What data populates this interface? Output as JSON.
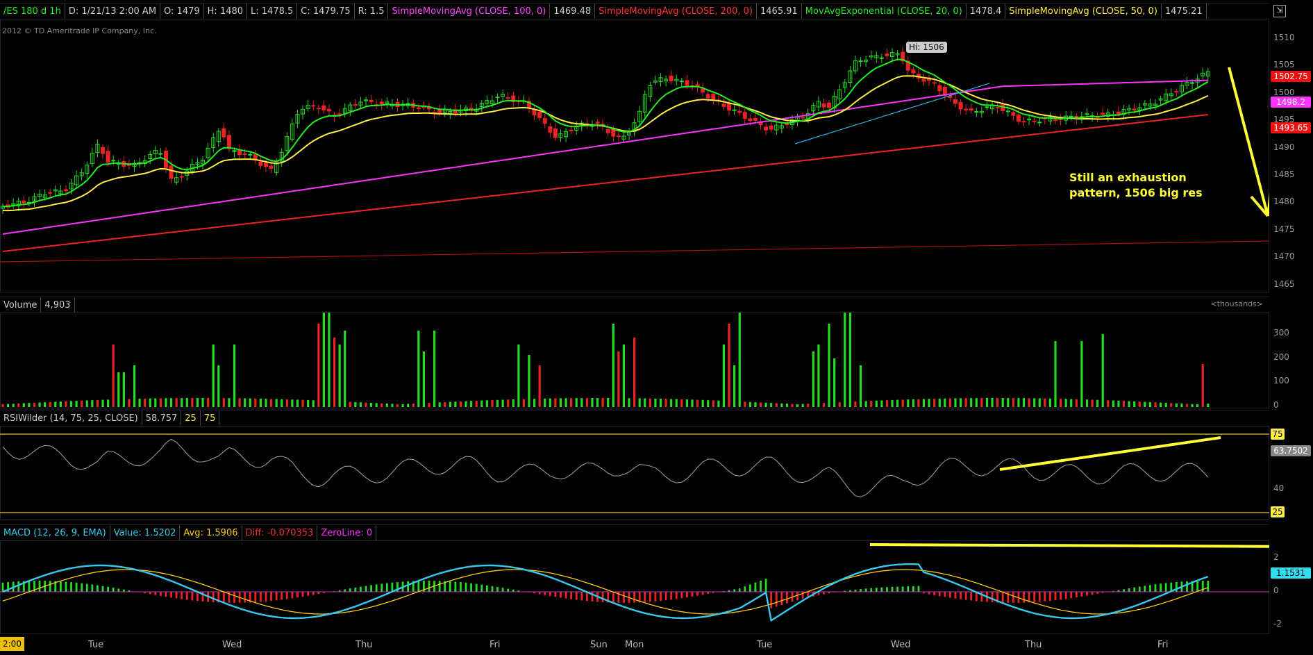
{
  "price_header": {
    "symbol": "/ES 180 d 1h",
    "date": "D: 1/21/13 2:00 AM",
    "open": "O: 1479",
    "high": "H: 1480",
    "low": "L: 1478.5",
    "close": "C: 1479.75",
    "range": "R: 1.5",
    "sma100_label": "SimpleMovingAvg (CLOSE, 100, 0)",
    "sma100_value": "1469.48",
    "sma200_label": "SimpleMovingAvg (CLOSE, 200, 0)",
    "sma200_value": "1465.91",
    "ema20_label": "MovAvgExponential (CLOSE, 20, 0)",
    "ema20_value": "1478.4",
    "sma50_label": "SimpleMovingAvg (CLOSE, 50, 0)",
    "sma50_value": "1475.21"
  },
  "copyright": "2012 © TD Ameritrade IP Company, Inc.",
  "hi_label": "Hi: 1506",
  "annotation": {
    "line1": "Still an exhaustion",
    "line2": "pattern, 1506 big res"
  },
  "price_axis": {
    "ticks": [
      "1510",
      "1505",
      "1500",
      "1495",
      "1490",
      "1485",
      "1480",
      "1475",
      "1470",
      "1465"
    ],
    "tag_last": "1502.75",
    "tag_sma100": "1498.2",
    "tag_sma200": "1493.65"
  },
  "volume_header": {
    "label": "Volume",
    "value": "4,903",
    "units": "<thousands>"
  },
  "volume_axis": [
    "300",
    "200",
    "100",
    "0"
  ],
  "rsi_header": {
    "label": "RSIWilder (14, 75, 25, CLOSE)",
    "value": "58.757",
    "lower": "25",
    "upper": "75"
  },
  "rsi_axis": {
    "upper": "75",
    "lower": "25",
    "mid": "40",
    "current": "63.7502"
  },
  "macd_header": {
    "label": "MACD (12, 26, 9, EMA)",
    "value": "Value: 1.5202",
    "avg": "Avg: 1.5906",
    "diff": "Diff: -0.070353",
    "zero": "ZeroLine: 0"
  },
  "macd_axis": {
    "top": "2",
    "zero": "0",
    "bottom": "-2",
    "current": "1.1531"
  },
  "time_axis": {
    "cursor": "2:00",
    "days": [
      "Tue",
      "Wed",
      "Thu",
      "Fri",
      "Sun",
      "Mon",
      "Tue",
      "Wed",
      "Thu",
      "Fri"
    ]
  },
  "colors": {
    "up": "#22dd22",
    "down": "#ee2222",
    "ema20": "#22ee22",
    "sma50": "#ffee44",
    "sma100": "#ff33ff",
    "sma200": "#ee2222",
    "macd": "#33ccee",
    "signal": "#ffcc00",
    "annotation": "#ffff33"
  }
}
